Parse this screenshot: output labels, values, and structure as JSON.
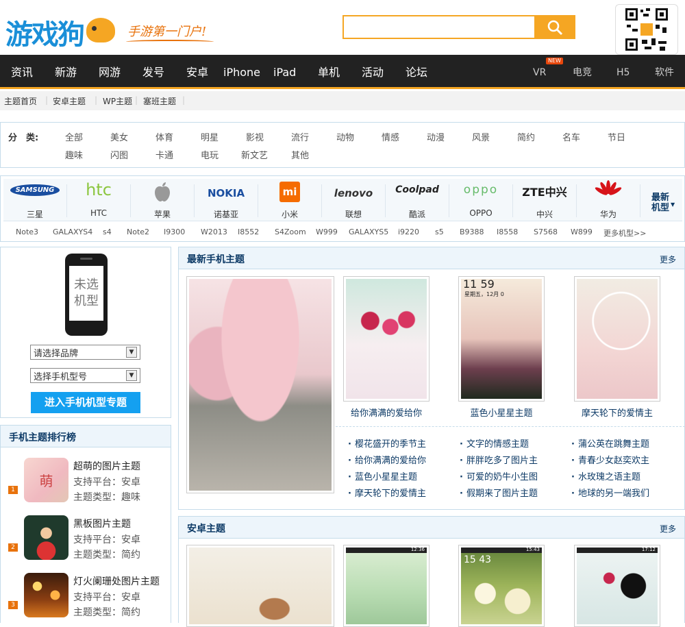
{
  "logo": {
    "brand": "游戏狗",
    "slogan": "手游第一门户!"
  },
  "search": {
    "placeholder": ""
  },
  "nav": {
    "main": [
      "资讯",
      "新游",
      "网游",
      "发号",
      "安卓",
      "iPhone",
      "iPad",
      "单机",
      "活动",
      "论坛"
    ],
    "side": [
      "VR",
      "电竞",
      "H5",
      "软件"
    ],
    "new_badge": "NEW"
  },
  "breadcrumb": [
    "主题首页",
    "安卓主题",
    "WP主题",
    "塞班主题"
  ],
  "categories": {
    "label": "分　类:",
    "row1": [
      "全部",
      "美女",
      "体育",
      "明星",
      "影视",
      "流行",
      "动物",
      "情感",
      "动漫",
      "风景",
      "简约",
      "名车",
      "节日"
    ],
    "row2": [
      "趣味",
      "闪图",
      "卡通",
      "电玩",
      "新文艺",
      "其他"
    ]
  },
  "brands": {
    "items": [
      {
        "logo": "SAMSUNG",
        "name": "三星",
        "color": "#1a4ea0"
      },
      {
        "logo": "htc",
        "name": "HTC",
        "color": "#8cc63f"
      },
      {
        "logo": "",
        "name": "苹果",
        "color": "#888888"
      },
      {
        "logo": "NOKIA",
        "name": "诺基亚",
        "color": "#1a4ea0"
      },
      {
        "logo": "mi",
        "name": "小米",
        "color": "#f56c00"
      },
      {
        "logo": "lenovo",
        "name": "联想",
        "color": "#333333"
      },
      {
        "logo": "Coolpad",
        "name": "酷派",
        "color": "#222222"
      },
      {
        "logo": "oppo",
        "name": "OPPO",
        "color": "#66bb6a"
      },
      {
        "logo": "ZTE中兴",
        "name": "中兴",
        "color": "#1a1a1a"
      },
      {
        "logo": "",
        "name": "华为",
        "color": "#d7141a"
      }
    ],
    "latest": "最新机型",
    "models": [
      "Note3",
      "GALAXYS4",
      "s4",
      "Note2",
      "I9300",
      "W2013",
      "I8552",
      "S4Zoom",
      "W999",
      "GALAXYS5",
      "i9220",
      "s5",
      "B9388",
      "I8558",
      "S7568",
      "W899",
      "更多机型>>"
    ]
  },
  "left": {
    "phone_text": "未选机型",
    "brand_select": "请选择品牌",
    "model_select": "选择手机型号",
    "enter": "进入手机机型专题",
    "ranking_title": "手机主题排行榜",
    "ranking": [
      {
        "num": "1",
        "name": "超萌的图片主题",
        "platform": "支持平台：安卓",
        "type": "主题类型：趣味",
        "mark": "萌"
      },
      {
        "num": "2",
        "name": "黑板图片主题",
        "platform": "支持平台：安卓",
        "type": "主题类型：简约"
      },
      {
        "num": "3",
        "name": "灯火阑珊处图片主题",
        "platform": "支持平台：安卓",
        "type": "主题类型：简约"
      }
    ]
  },
  "latest": {
    "title": "最新手机主题",
    "more": "更多",
    "thumbs": [
      "给你满满的爱给你",
      "蓝色小星星主题",
      "摩天轮下的爱情主"
    ],
    "clock_time": "11 59",
    "clock_date": "星期五，12月 0",
    "list": [
      [
        "樱花盛开的季节主",
        "给你满满的爱给你",
        "蓝色小星星主题",
        "摩天轮下的爱情主"
      ],
      [
        "文字的情感主题",
        "胖胖吃多了图片主",
        "可爱的奶牛小生图",
        "假期来了图片主题"
      ],
      [
        "蒲公英在跳舞主题",
        "青春少女赵奕欢主",
        "水玫瑰之语主题",
        "地球的另一端我们"
      ]
    ]
  },
  "android": {
    "title": "安卓主题",
    "more": "更多",
    "time1": "12:36",
    "time2": "15:43",
    "time3": "17:12",
    "clock": "15 43"
  }
}
